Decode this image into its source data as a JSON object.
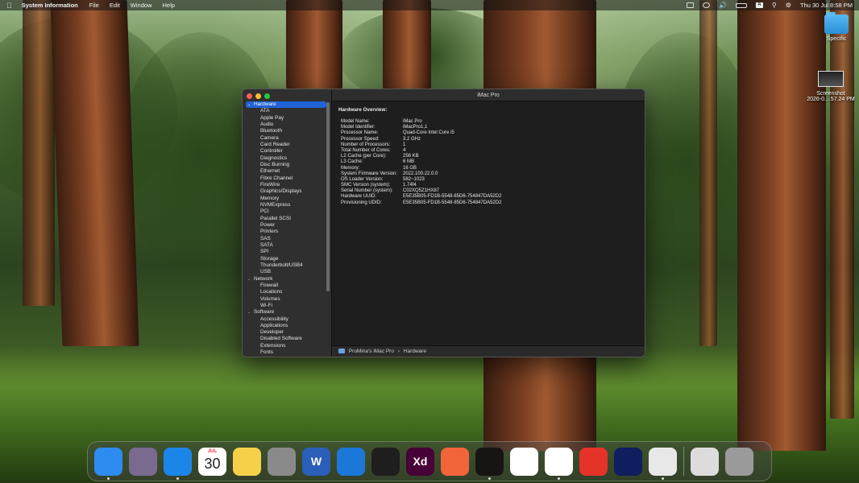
{
  "menubar": {
    "app_name": "System Information",
    "items": [
      "File",
      "Edit",
      "Window",
      "Help"
    ],
    "datetime": "Thu 30 Jul  8:58 PM",
    "input_source": "A"
  },
  "desktop": {
    "folder_label": "Specific",
    "screenshot_label_1": "Screenshot",
    "screenshot_label_2": "2026-0....57.24 PM"
  },
  "window": {
    "title": "iMac Pro",
    "sidebar": {
      "categories": [
        {
          "label": "Hardware",
          "selected": true,
          "items": [
            "ATA",
            "Apple Pay",
            "Audio",
            "Bluetooth",
            "Camera",
            "Card Reader",
            "Controller",
            "Diagnostics",
            "Disc Burning",
            "Ethernet",
            "Fibre Channel",
            "FireWire",
            "Graphics/Displays",
            "Memory",
            "NVMExpress",
            "PCI",
            "Parallel SCSI",
            "Power",
            "Printers",
            "SAS",
            "SATA",
            "SPI",
            "Storage",
            "Thunderbolt/USB4",
            "USB"
          ]
        },
        {
          "label": "Network",
          "selected": false,
          "items": [
            "Firewall",
            "Locations",
            "Volumes",
            "Wi-Fi"
          ]
        },
        {
          "label": "Software",
          "selected": false,
          "items": [
            "Accessibility",
            "Applications",
            "Developer",
            "Disabled Software",
            "Extensions",
            "Fonts"
          ]
        }
      ]
    },
    "overview": {
      "heading": "Hardware Overview:",
      "rows": [
        {
          "k": "Model Name:",
          "v": "iMac Pro"
        },
        {
          "k": "Model Identifier:",
          "v": "iMacPro1,1"
        },
        {
          "k": "Processor Name:",
          "v": "Quad-Core Intel Core i5"
        },
        {
          "k": "Processor Speed:",
          "v": "3.2 GHz"
        },
        {
          "k": "Number of Processors:",
          "v": "1"
        },
        {
          "k": "Total Number of Cores:",
          "v": "4"
        },
        {
          "k": "L2 Cache (per Core):",
          "v": "256 KB"
        },
        {
          "k": "L3 Cache:",
          "v": "6 MB"
        },
        {
          "k": "Memory:",
          "v": "16 GB"
        },
        {
          "k": "System Firmware Version:",
          "v": "2022.100.22.0.0"
        },
        {
          "k": "OS Loader Version:",
          "v": "582~1023"
        },
        {
          "k": "SMC Version (system):",
          "v": "1.74f4"
        },
        {
          "k": "Serial Number (system):",
          "v": "C02XQ5Z1HX87"
        },
        {
          "k": "Hardware UUID:",
          "v": "E5E35B05-FD1B-5548-85D6-754847DA52D2"
        },
        {
          "k": "Provisioning UDID:",
          "v": "E5E35B05-FD1B-5548-85D6-754847DA52D2"
        }
      ]
    },
    "pathbar": {
      "computer": "ProMina's iMac Pro",
      "separator": "›",
      "section": "Hardware"
    }
  },
  "dock": {
    "apps": [
      {
        "name": "finder-icon",
        "label": "",
        "color": "#2e8bf0",
        "running": true
      },
      {
        "name": "launchpad-icon",
        "label": "",
        "color": "#7a6a8f",
        "running": false
      },
      {
        "name": "safari-icon",
        "label": "",
        "color": "#1c86e8",
        "running": true
      },
      {
        "name": "calendar-icon",
        "label": "",
        "color": "#ffffff",
        "running": false,
        "month": "JUL",
        "day": "30"
      },
      {
        "name": "notes-icon",
        "label": "",
        "color": "#f7d04a",
        "running": false
      },
      {
        "name": "system-settings-icon",
        "label": "",
        "color": "#8a8a8a",
        "running": false
      },
      {
        "name": "word-icon",
        "label": "W",
        "color": "#2b5eb8",
        "running": false
      },
      {
        "name": "xcode-icon",
        "label": "",
        "color": "#1b78d9",
        "running": false
      },
      {
        "name": "figma-icon",
        "label": "",
        "color": "#1e1e1e",
        "running": false
      },
      {
        "name": "adobe-xd-icon",
        "label": "Xd",
        "color": "#470137",
        "running": false
      },
      {
        "name": "pen-app-icon",
        "label": "",
        "color": "#f2643a",
        "running": false
      },
      {
        "name": "spotify-icon",
        "label": "",
        "color": "#191414",
        "running": true
      },
      {
        "name": "vscode-icon",
        "label": "",
        "color": "#ffffff",
        "running": false
      },
      {
        "name": "chrome-icon",
        "label": "",
        "color": "#ffffff",
        "running": true
      },
      {
        "name": "anydesk-icon",
        "label": "",
        "color": "#e5332a",
        "running": false
      },
      {
        "name": "teamviewer-icon",
        "label": "",
        "color": "#0e1e5e",
        "running": false
      },
      {
        "name": "system-information-icon",
        "label": "",
        "color": "#e8e8e8",
        "running": true
      },
      {
        "name": "downloads-icon",
        "label": "",
        "color": "#dcdcdc",
        "running": false
      },
      {
        "name": "trash-icon",
        "label": "",
        "color": "#9a9a9a",
        "running": false
      }
    ]
  }
}
